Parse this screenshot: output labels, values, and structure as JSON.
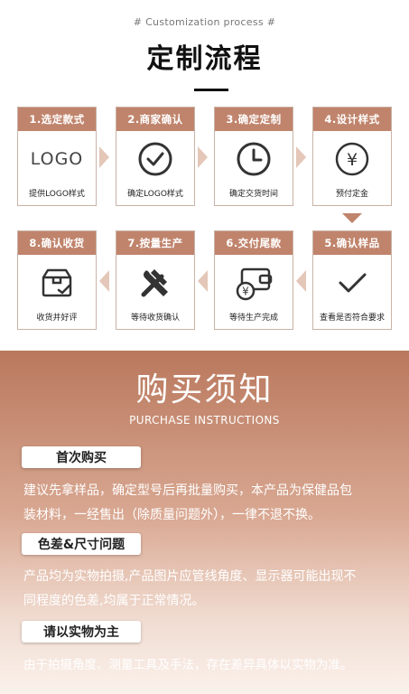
{
  "header": {
    "subtitle": "# Customization process #",
    "title": "定制流程"
  },
  "steps": [
    {
      "head": "1.选定款式",
      "caption": "提供LOGO样式",
      "icon": "logo-text",
      "logo_text": "LOGO"
    },
    {
      "head": "2.商家确认",
      "caption": "确定LOGO样式",
      "icon": "check-circle-icon"
    },
    {
      "head": "3.确定定制",
      "caption": "确定交货时间",
      "icon": "clock-icon"
    },
    {
      "head": "4.设计样式",
      "caption": "预付定金",
      "icon": "yen-circle-icon",
      "symbol": "¥"
    },
    {
      "head": "5.确认样品",
      "caption": "查看是否符合要求",
      "icon": "checkmark-icon"
    },
    {
      "head": "6.交付尾款",
      "caption": "等待生产完成",
      "icon": "wallet-icon",
      "symbol": "¥"
    },
    {
      "head": "7.按量生产",
      "caption": "等待收货确认",
      "icon": "tools-icon"
    },
    {
      "head": "8.确认收货",
      "caption": "收货并好评",
      "icon": "box-check-icon"
    }
  ],
  "purchase": {
    "title": "购买须知",
    "subtitle": "PURCHASE INSTRUCTIONS",
    "sections": [
      {
        "label": "首次购买",
        "text_line1": "建议先拿样品，确定型号后再批量购买，本产品为保健品包",
        "text_line2": "装材料，一经售出（除质量问题外），一律不退不换。"
      },
      {
        "label": "色差&尺寸问题",
        "text_line1": "产品均为实物拍摄,产品图片应管线角度、显示器可能出现不",
        "text_line2": "同程度的色差,均属于正常情况。"
      },
      {
        "label": "请以实物为主",
        "text_line1": "由于拍摄角度、测量工具及手法，存在差异具体以实物为准。"
      }
    ]
  },
  "colors": {
    "accent": "#c0846c",
    "arrow": "#e4c7b8",
    "border": "#c9b3a6"
  }
}
